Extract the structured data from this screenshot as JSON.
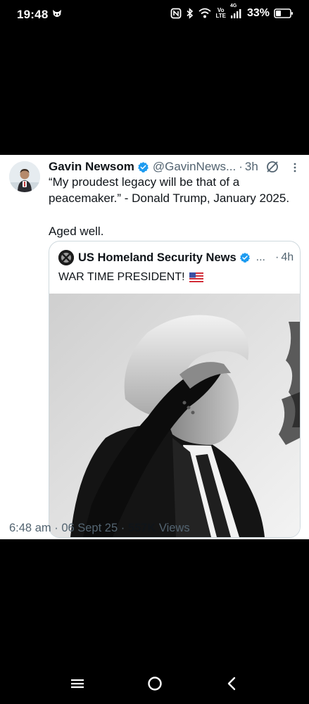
{
  "status_bar": {
    "time": "19:48",
    "battery": "33%",
    "network_top": "Vo",
    "network_bottom": "LTE",
    "signal_label": "4G"
  },
  "tweet": {
    "author": {
      "name": "Gavin Newsom",
      "handle": "@GavinNews...",
      "verified": true
    },
    "separator": "·",
    "time": "3h",
    "text_lines": [
      "“My proudest legacy will be that of a",
      "peacemaker.” - Donald Trump, January 2025."
    ],
    "text_line_2": "Aged well.",
    "quote": {
      "author_name": "US Homeland Security News",
      "ellipsis": "...",
      "separator": "·",
      "time": "4h",
      "text": "WAR TIME PRESIDENT!",
      "flag": "us-flag-emoji",
      "image": "black-and-white photo of Donald Trump saluting"
    },
    "footer": {
      "time": "6:48 am",
      "separator1": "·",
      "date": "06 Sept 25",
      "separator2": "·",
      "views_count": "557K",
      "views_label": "Views"
    }
  },
  "icons": {
    "verified": "verified-badge-icon",
    "grok": "grok-icon",
    "more": "more-vertical-icon"
  },
  "colors": {
    "verified_blue": "#1d9bf0",
    "secondary_text": "#536471",
    "primary_text": "#0f1419",
    "background": "#000000",
    "card": "#ffffff"
  }
}
